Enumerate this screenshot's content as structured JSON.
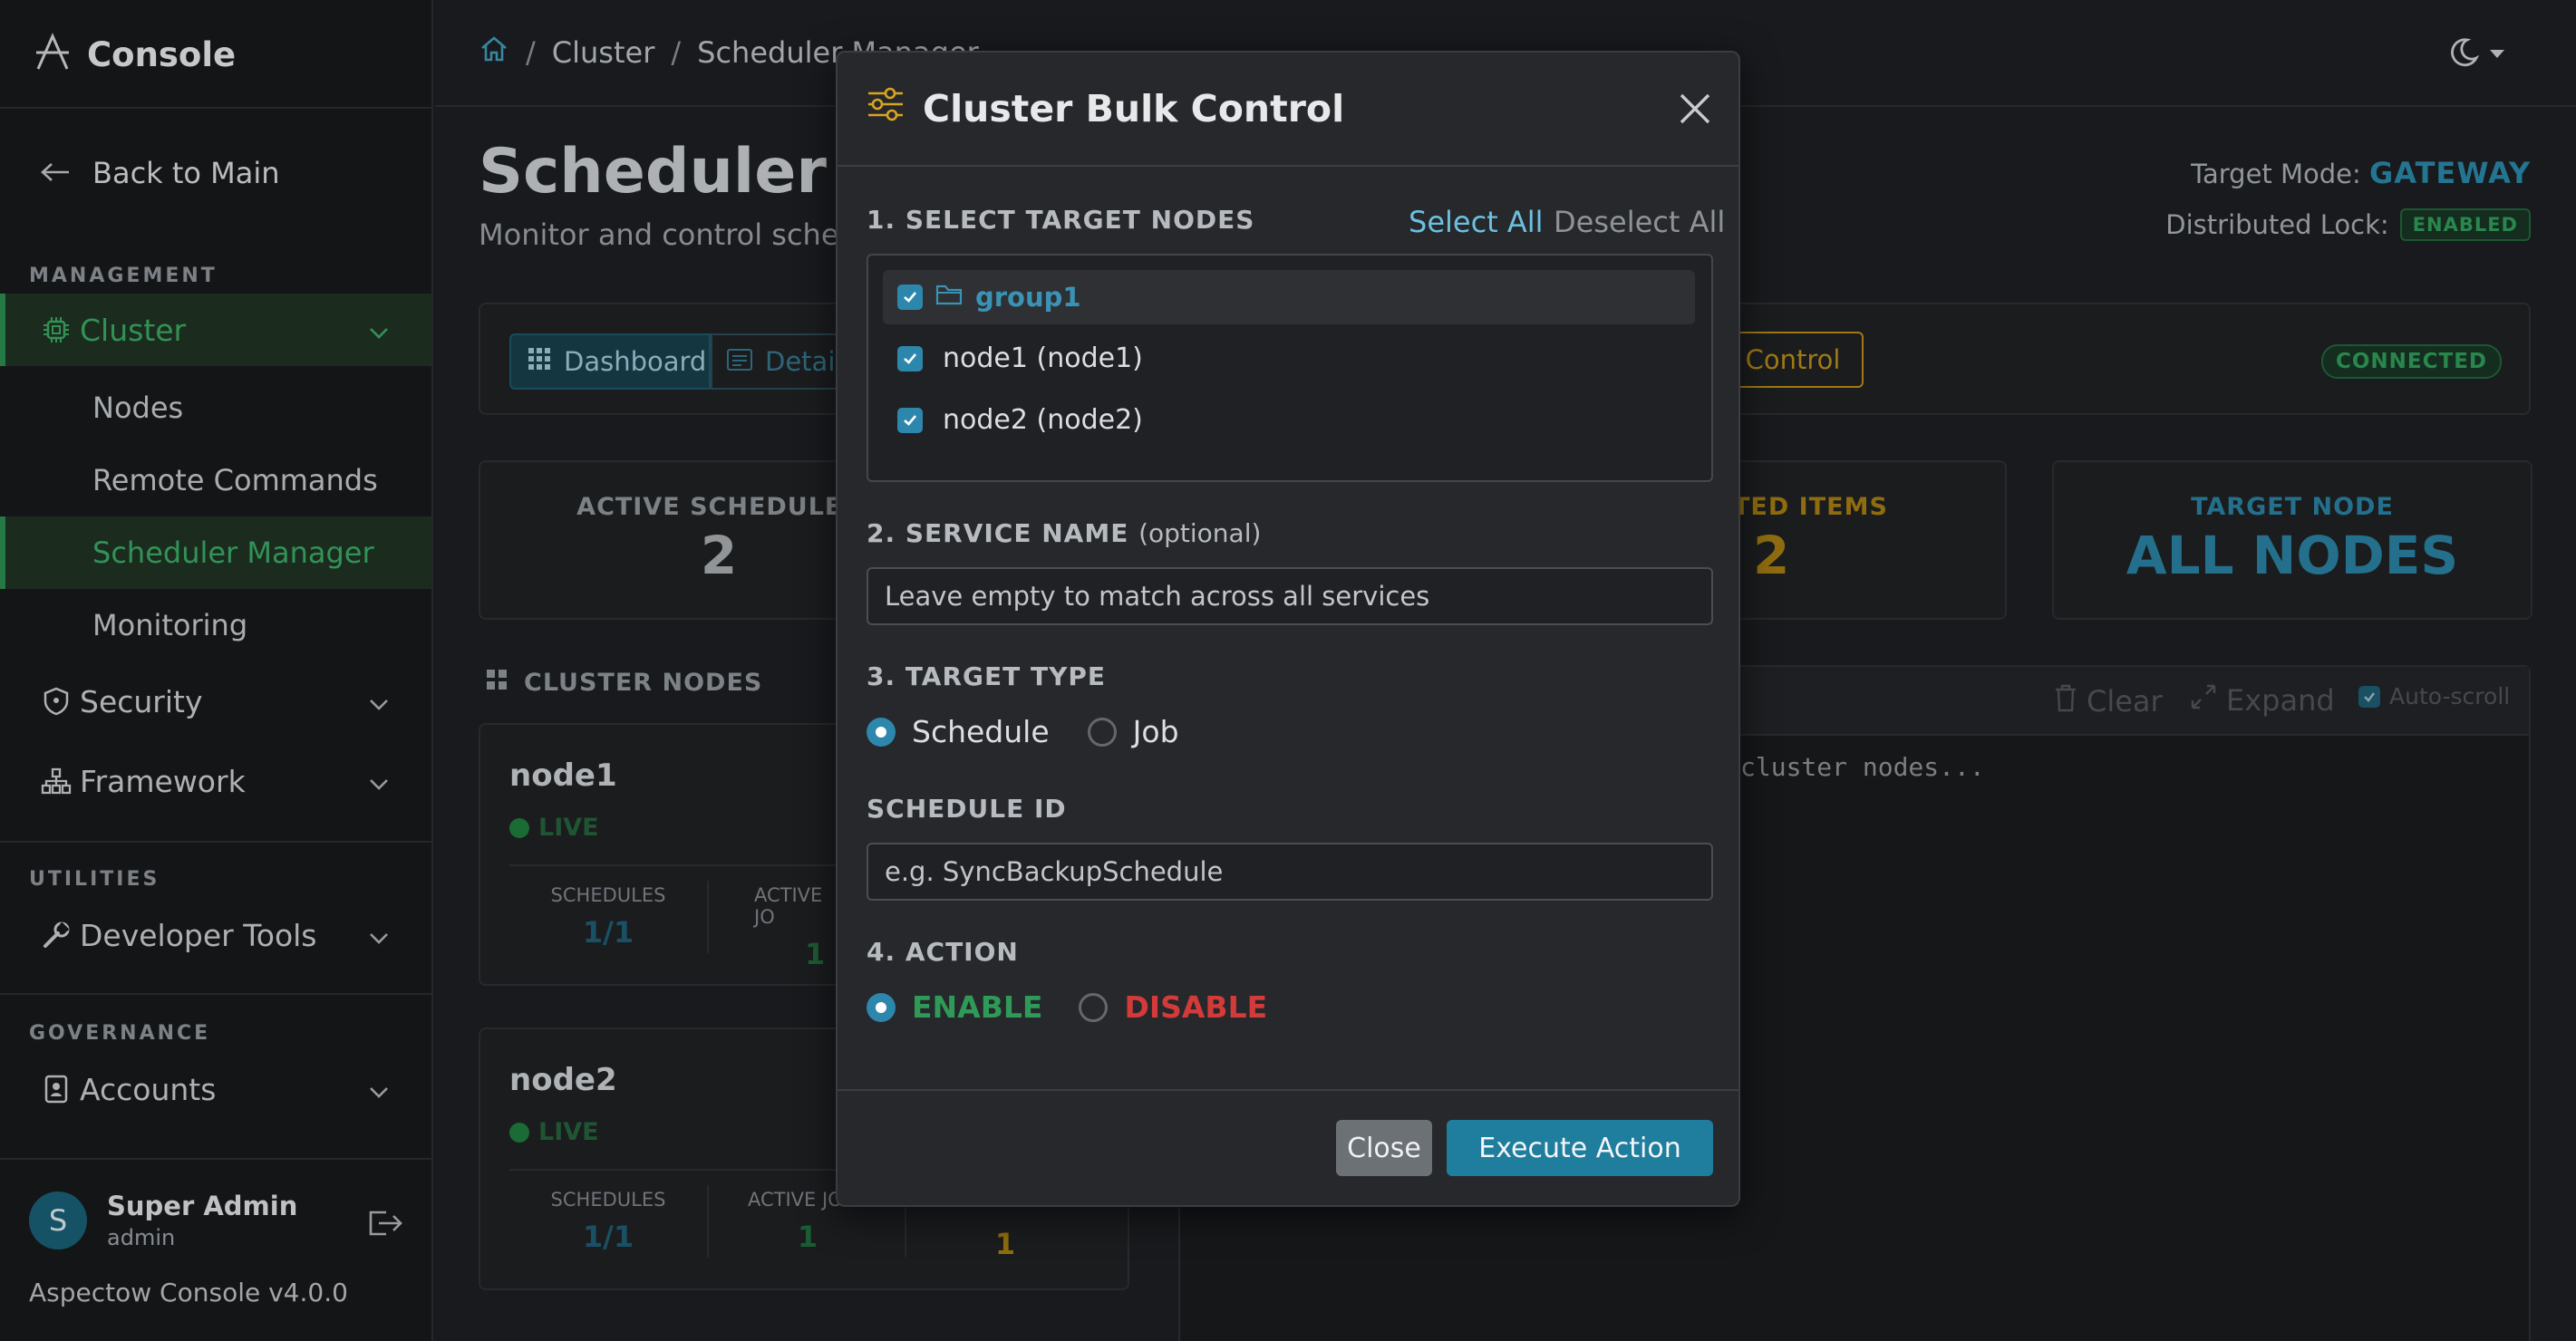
{
  "brand": {
    "name": "Console"
  },
  "sidebar": {
    "back_label": "Back to Main",
    "sections": {
      "management": "MANAGEMENT",
      "utilities": "UTILITIES",
      "governance": "GOVERNANCE"
    },
    "cluster": "Cluster",
    "cluster_children": [
      "Nodes",
      "Remote Commands",
      "Scheduler Manager",
      "Monitoring"
    ],
    "security": "Security",
    "framework": "Framework",
    "developer_tools": "Developer Tools",
    "accounts": "Accounts",
    "user": {
      "initial": "S",
      "name": "Super Admin",
      "role": "admin"
    },
    "version": "Aspectow Console v4.0.0"
  },
  "breadcrumb": {
    "items": [
      "Cluster",
      "Scheduler Manager"
    ],
    "separator": "/"
  },
  "page": {
    "title": "Scheduler Manager",
    "subtitle": "Monitor and control schedules",
    "target_mode_label": "Target Mode:",
    "target_mode_value": "GATEWAY",
    "lock_label": "Distributed Lock:",
    "lock_status": "ENABLED"
  },
  "toolbar": {
    "dashboard": "Dashboard",
    "detail": "Detail",
    "control": "Control",
    "status": "CONNECTED"
  },
  "stats": [
    {
      "label": "ACTIVE SCHEDULES",
      "value": "2"
    },
    {
      "label": "TED ITEMS",
      "value": "2"
    },
    {
      "label": "TARGET NODE",
      "value": "ALL NODES"
    }
  ],
  "cluster_nodes": {
    "heading": "CLUSTER NODES",
    "nodes": [
      {
        "name": "node1",
        "status": "LIVE",
        "schedules_label": "SCHEDULES",
        "schedules": "1/1",
        "active_jobs_label": "ACTIVE JO",
        "active_jobs": "1"
      },
      {
        "name": "node2",
        "status": "LIVE",
        "schedules_label": "SCHEDULES",
        "schedules": "1/1",
        "active_jobs_label": "ACTIVE JOBS",
        "active_jobs": "1",
        "isolated": "1"
      }
    ]
  },
  "log": {
    "clear": "Clear",
    "expand": "Expand",
    "autoscroll": "Auto-scroll",
    "text": "cluster nodes..."
  },
  "modal": {
    "title": "Cluster Bulk Control",
    "sec1": "1. SELECT TARGET NODES",
    "select_all": "Select All",
    "deselect_all": "Deselect All",
    "group": "group1",
    "nodes": [
      "node1 (node1)",
      "node2 (node2)"
    ],
    "sec2": "2. SERVICE NAME",
    "sec2_optional": "(optional)",
    "service_placeholder": "Leave empty to match across all services",
    "sec3": "3. TARGET TYPE",
    "types": [
      "Schedule",
      "Job"
    ],
    "schedule_id_label": "SCHEDULE ID",
    "schedule_placeholder": "e.g. SyncBackupSchedule",
    "sec4": "4. ACTION",
    "actions": [
      "ENABLE",
      "DISABLE"
    ],
    "close_btn": "Close",
    "execute_btn": "Execute Action"
  },
  "colors": {
    "accent": "#2d87ad",
    "enable": "#2f9a58",
    "disable": "#d33a3a",
    "gold": "#b58a16"
  }
}
